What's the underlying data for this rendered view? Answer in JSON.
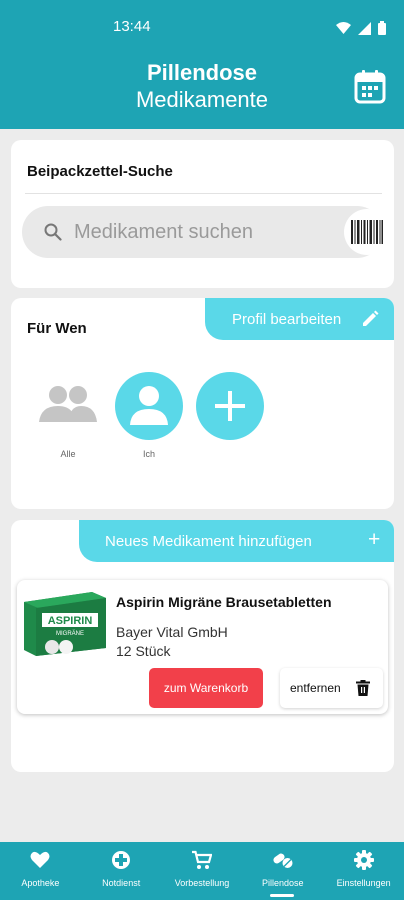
{
  "status_bar": {
    "time": "13:44"
  },
  "header": {
    "title": "Pillendose",
    "subtitle": "Medikamente"
  },
  "search_section": {
    "title": "Beipackzettel-Suche",
    "placeholder": "Medikament suchen"
  },
  "who_section": {
    "title": "Für Wen",
    "edit_profile_label": "Profil bearbeiten",
    "people": [
      {
        "label": "Alle"
      },
      {
        "label": "Ich"
      }
    ]
  },
  "meds_section": {
    "add_label": "Neues Medikament hinzufügen",
    "add_symbol": "+",
    "items": [
      {
        "name": "Aspirin Migräne Brausetabletten",
        "manufacturer": "Bayer Vital GmbH",
        "quantity": "12 Stück",
        "cart_label": "zum Warenkorb",
        "remove_label": "entfernen",
        "image_brand": "ASPIRIN",
        "image_sub": "MIGRÄNE"
      }
    ]
  },
  "bottom_nav": {
    "items": [
      {
        "label": "Apotheke",
        "icon": "heart-icon"
      },
      {
        "label": "Notdienst",
        "icon": "emergency-icon"
      },
      {
        "label": "Vorbestellung",
        "icon": "cart-icon"
      },
      {
        "label": "Pillendose",
        "icon": "pills-icon",
        "active": true
      },
      {
        "label": "Einstellungen",
        "icon": "gear-icon"
      }
    ]
  },
  "colors": {
    "primary": "#1ea4b4",
    "accent": "#5ad8e8",
    "danger": "#f2404a",
    "background": "#ececec"
  }
}
